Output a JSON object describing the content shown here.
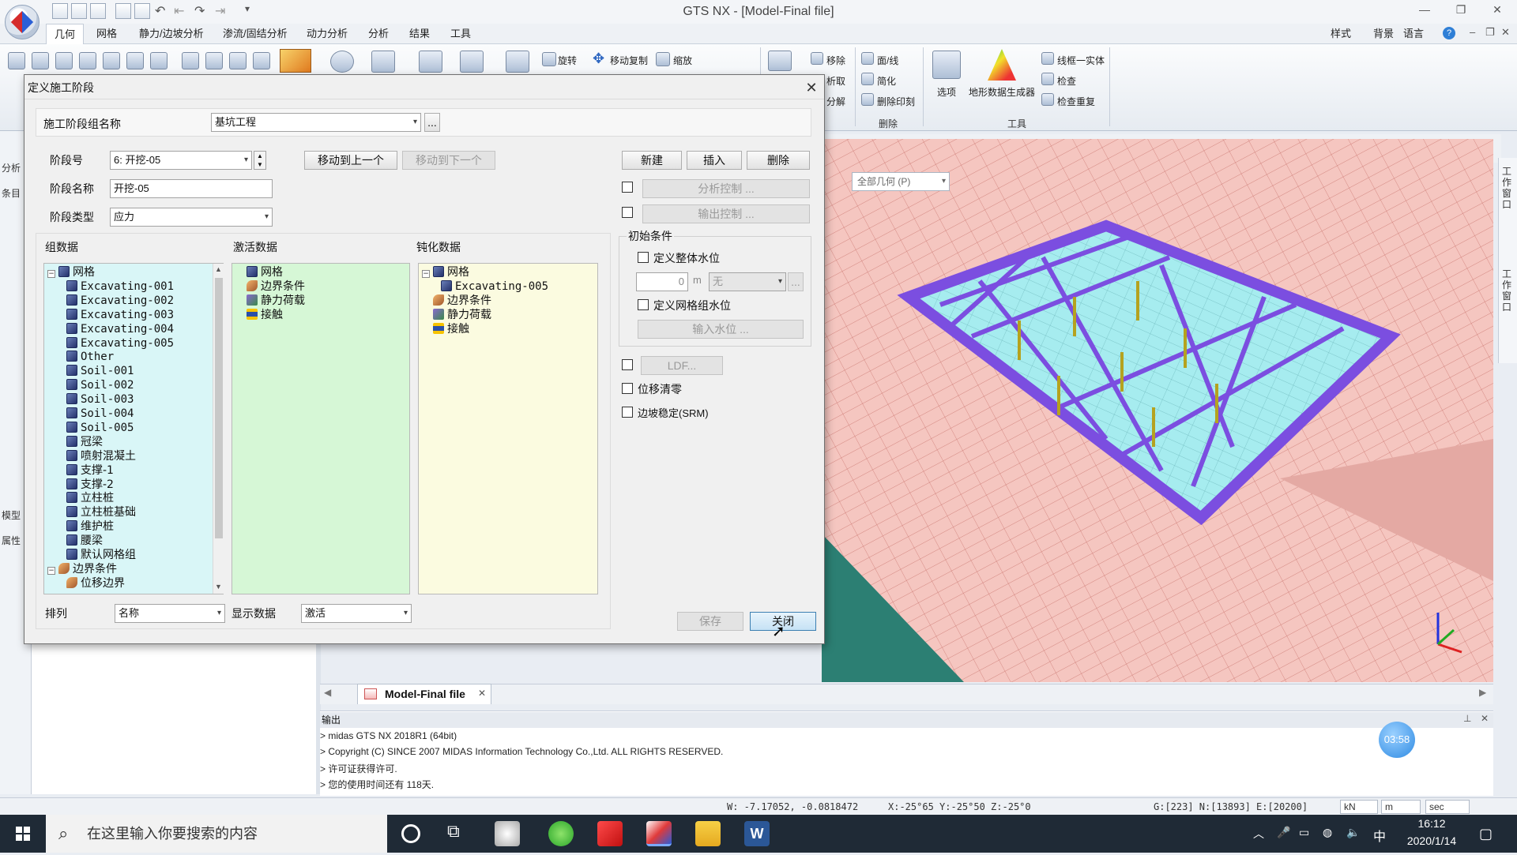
{
  "app": {
    "window_title": "GTS NX - [Model-Final file]"
  },
  "menu": {
    "items": [
      "几何",
      "网格",
      "静力/边坡分析",
      "渗流/固结分析",
      "动力分析",
      "分析",
      "结果",
      "工具"
    ],
    "right": [
      "样式",
      "背景",
      "语言"
    ]
  },
  "ribbon": {
    "labels": {
      "rotate": "旋转",
      "move_copy": "移动复制",
      "scale": "缩放",
      "remove": "移除",
      "analyze": "析取",
      "divide": "分解",
      "face_line": "面/线",
      "simplify": "简化",
      "delete_imprint": "删除印刻",
      "options": "选项",
      "terrain": "地形数据生成器",
      "wire_solid": "线框一实体",
      "check": "检查",
      "check_dup": "检查重复"
    },
    "groups": {
      "delete": "删除",
      "tools": "工具"
    }
  },
  "left_panel": {
    "analysis": "分析",
    "item": "条目",
    "model": "模型",
    "properties": "属性"
  },
  "viewport": {
    "geometry_select": "全部几何 (P)"
  },
  "right_panel": {
    "tab1": "工作窗口",
    "tab2": "工作窗口"
  },
  "tabs": {
    "model_tab": "Model-Final file"
  },
  "output": {
    "title": "输出",
    "lines": [
      "> midas GTS NX 2018R1 (64bit)",
      "> Copyright (C) SINCE 2007 MIDAS Information Technology Co.,Ltd. ALL RIGHTS RESERVED.",
      "> 许可证获得许可.",
      "> 您的使用时间还有 118天."
    ],
    "timer": "03:58"
  },
  "status": {
    "w_coords": "W: -7.17052, -0.0818472",
    "xyz": "X:-25°65 Y:-25°50 Z:-25°0",
    "counts": "G:[223] N:[13893] E:[20200]",
    "unit_force": "kN",
    "unit_length": "m",
    "unit_time": "sec"
  },
  "taskbar": {
    "search_placeholder": "在这里输入你要搜索的内容",
    "time": "16:12",
    "date": "2020/1/14",
    "ime": "中"
  },
  "dialog": {
    "title": "定义施工阶段",
    "stage_group_label": "施工阶段组名称",
    "stage_group_value": "基坑工程",
    "browse_label": "...",
    "stage_no_label": "阶段号",
    "stage_no_value": "6: 开挖-05",
    "move_up": "移动到上一个",
    "move_down": "移动到下一个",
    "new": "新建",
    "insert": "插入",
    "delete": "删除",
    "stage_name_label": "阶段名称",
    "stage_name_value": "开挖-05",
    "stage_type_label": "阶段类型",
    "stage_type_value": "应力",
    "analysis_control": "分析控制 ...",
    "output_control": "输出控制 ...",
    "group_data": "组数据",
    "activate_data": "激活数据",
    "deactivate_data": "钝化数据",
    "initial_conditions": "初始条件",
    "define_water_level": "定义整体水位",
    "water_value": "0",
    "water_unit": "m",
    "water_none": "无",
    "define_mesh_water": "定义网格组水位",
    "input_water": "输入水位 ...",
    "ldf": "LDF...",
    "disp_clear": "位移清零",
    "slope_stability": "边坡稳定(SRM)",
    "sort_label": "排列",
    "sort_value": "名称",
    "display_label": "显示数据",
    "display_value": "激活",
    "save": "保存",
    "close": "关闭",
    "group_tree": [
      {
        "label": "网格",
        "type": "mesh",
        "level": 0,
        "expander": "−"
      },
      {
        "label": "Excavating-001",
        "type": "mesh",
        "level": 1
      },
      {
        "label": "Excavating-002",
        "type": "mesh",
        "level": 1
      },
      {
        "label": "Excavating-003",
        "type": "mesh",
        "level": 1
      },
      {
        "label": "Excavating-004",
        "type": "mesh",
        "level": 1
      },
      {
        "label": "Excavating-005",
        "type": "mesh",
        "level": 1
      },
      {
        "label": "Other",
        "type": "mesh",
        "level": 1
      },
      {
        "label": "Soil-001",
        "type": "mesh",
        "level": 1
      },
      {
        "label": "Soil-002",
        "type": "mesh",
        "level": 1
      },
      {
        "label": "Soil-003",
        "type": "mesh",
        "level": 1
      },
      {
        "label": "Soil-004",
        "type": "mesh",
        "level": 1
      },
      {
        "label": "Soil-005",
        "type": "mesh",
        "level": 1
      },
      {
        "label": "冠梁",
        "type": "mesh",
        "level": 1
      },
      {
        "label": "喷射混凝土",
        "type": "mesh",
        "level": 1
      },
      {
        "label": "支撑-1",
        "type": "mesh",
        "level": 1
      },
      {
        "label": "支撑-2",
        "type": "mesh",
        "level": 1
      },
      {
        "label": "立柱桩",
        "type": "mesh",
        "level": 1
      },
      {
        "label": "立柱桩基础",
        "type": "mesh",
        "level": 1
      },
      {
        "label": "维护桩",
        "type": "mesh",
        "level": 1
      },
      {
        "label": "腰梁",
        "type": "mesh",
        "level": 1
      },
      {
        "label": "默认网格组",
        "type": "mesh",
        "level": 1
      },
      {
        "label": "边界条件",
        "type": "bc",
        "level": 0,
        "expander": "−"
      },
      {
        "label": "位移边界",
        "type": "bc",
        "level": 1
      }
    ],
    "activate_tree": [
      {
        "label": "网格",
        "type": "mesh"
      },
      {
        "label": "边界条件",
        "type": "bc"
      },
      {
        "label": "静力荷载",
        "type": "load"
      },
      {
        "label": "接触",
        "type": "contact"
      }
    ],
    "deactivate_tree": [
      {
        "label": "网格",
        "type": "mesh",
        "level": 0,
        "expander": "−"
      },
      {
        "label": "Excavating-005",
        "type": "mesh",
        "level": 1
      },
      {
        "label": "边界条件",
        "type": "bc",
        "level": 0
      },
      {
        "label": "静力荷载",
        "type": "load",
        "level": 0
      },
      {
        "label": "接触",
        "type": "contact",
        "level": 0
      }
    ]
  },
  "colors": {
    "group_panel": "#d9f6f7",
    "activate_panel": "#d6f7d6",
    "deactivate_panel": "#fbfbe0",
    "soil": "#f5c6c0",
    "strut": "#7b4ee0",
    "excavation": "#a6ecef"
  }
}
